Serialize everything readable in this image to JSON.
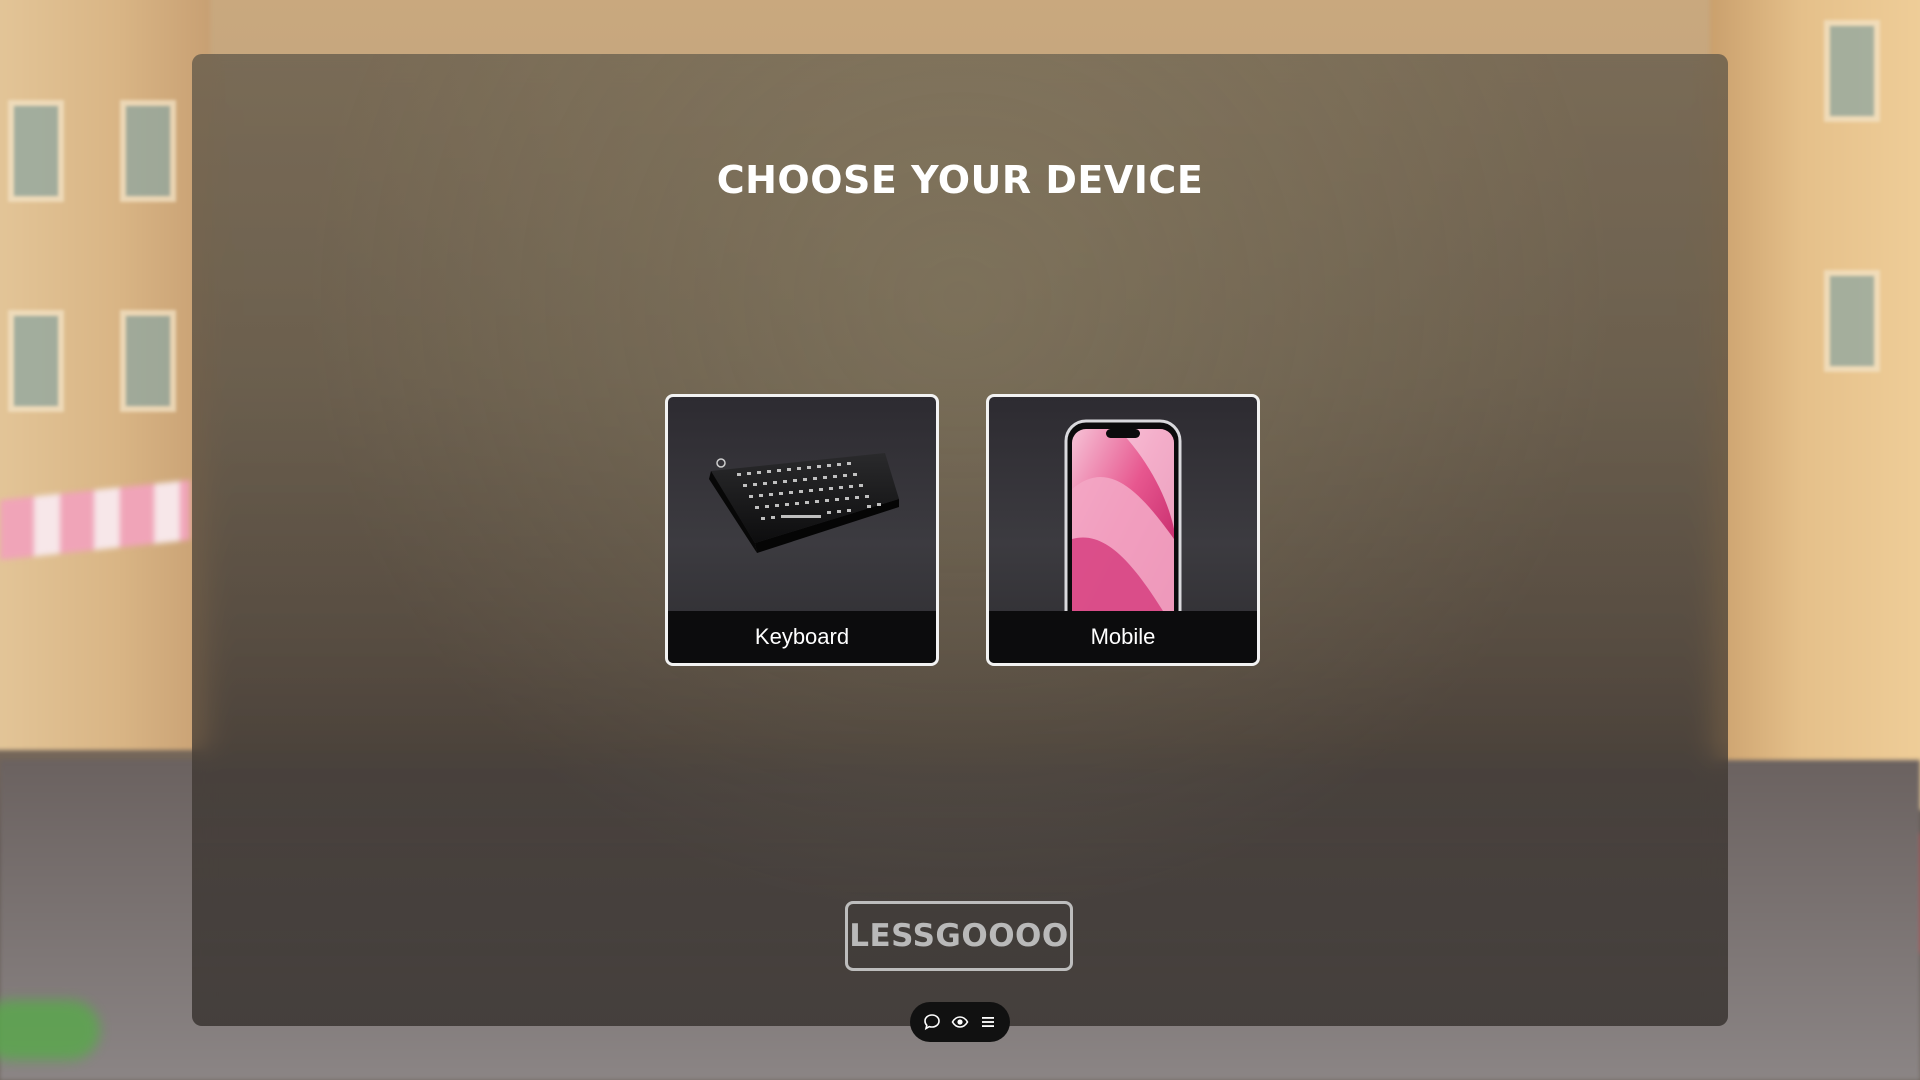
{
  "modal": {
    "title": "CHOOSE YOUR DEVICE",
    "options": [
      {
        "label": "Keyboard",
        "icon": "keyboard-image"
      },
      {
        "label": "Mobile",
        "icon": "smartphone-image"
      }
    ],
    "confirm_label": "LESSGOOOO"
  },
  "toolbar": {
    "buttons": [
      {
        "icon": "chat-bubble-icon"
      },
      {
        "icon": "eye-icon"
      },
      {
        "icon": "menu-icon"
      }
    ]
  },
  "colors": {
    "title_text": "#ffffff",
    "card_border": "#f2f2f2",
    "card_label_bar": "#0c0c0d",
    "confirm_border": "#bdbdbd",
    "confirm_text": "#b9b9b9",
    "toolbar_bg": "#111111",
    "phone_screen_pink": "#e7578f"
  }
}
